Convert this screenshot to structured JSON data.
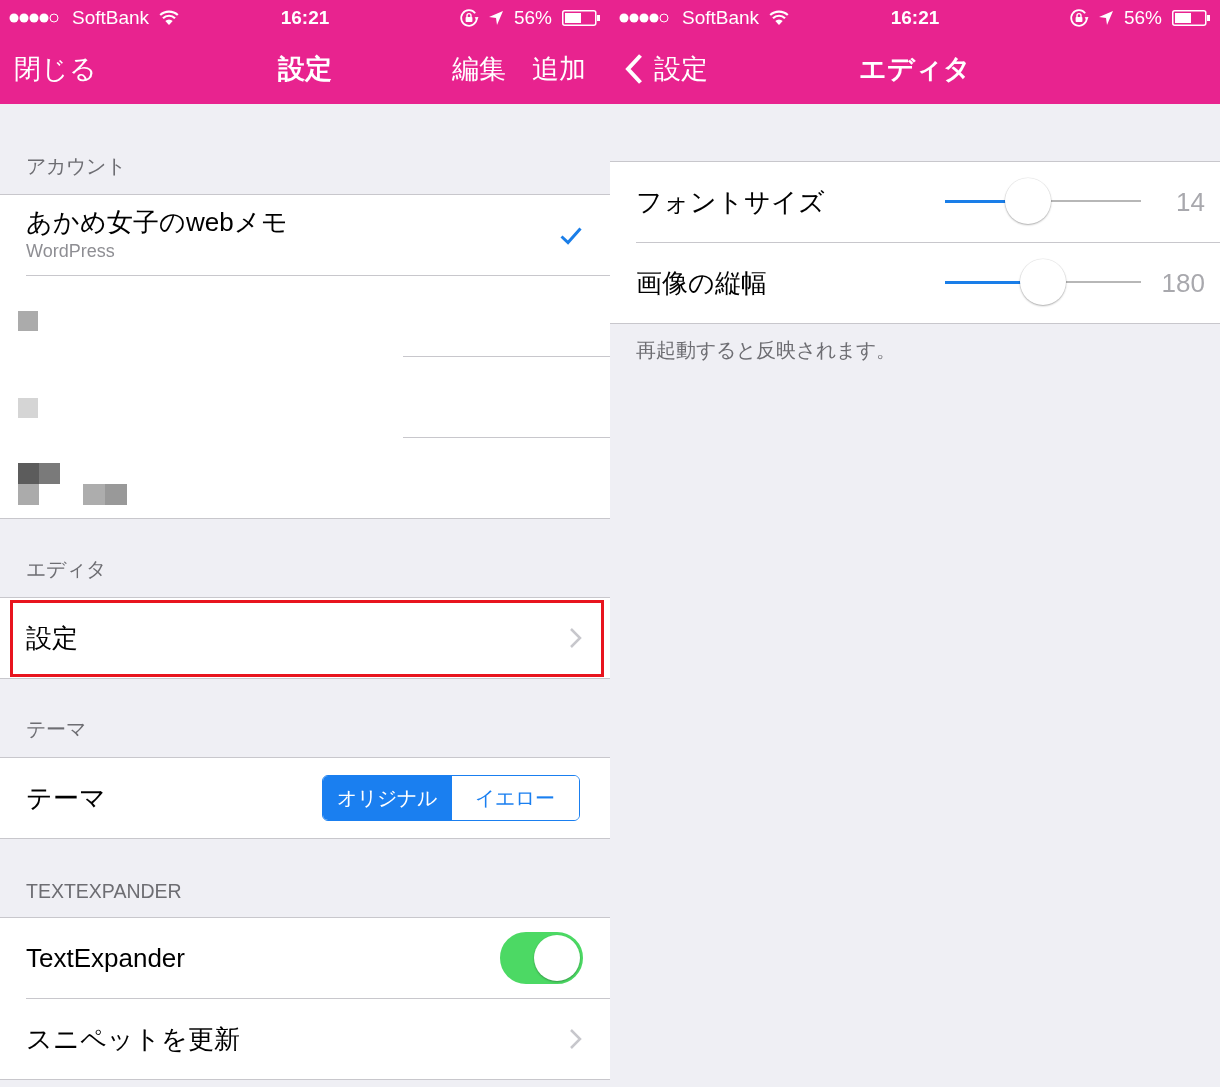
{
  "settings_screen": {
    "status_bar": {
      "carrier": "SoftBank",
      "time": "16:21",
      "battery": "56%"
    },
    "nav_bar": {
      "left_button": "閉じる",
      "title": "設定",
      "right_buttons": [
        "編集",
        "追加"
      ]
    },
    "sections": [
      {
        "header": "アカウント",
        "rows": [
          {
            "kind": "account",
            "title": "あかめ女子のwebメモ",
            "subtitle": "WordPress",
            "selected": true
          },
          {
            "kind": "redacted",
            "selected": false
          },
          {
            "kind": "redacted",
            "selected": false
          },
          {
            "kind": "redacted",
            "selected": false
          }
        ]
      },
      {
        "header": "エディタ",
        "rows": [
          {
            "kind": "link",
            "title": "設定",
            "highlighted": true
          }
        ]
      },
      {
        "header": "テーマ",
        "rows": [
          {
            "kind": "segmented",
            "title": "テーマ",
            "segments": [
              {
                "label": "オリジナル",
                "selected": true
              },
              {
                "label": "イエロー",
                "selected": false
              }
            ]
          }
        ]
      },
      {
        "header": "TEXTEXPANDER",
        "rows": [
          {
            "kind": "toggle",
            "title": "TextExpander",
            "on": true
          },
          {
            "kind": "link",
            "title": "スニペットを更新",
            "highlighted": false
          }
        ]
      }
    ]
  },
  "editor_screen": {
    "status_bar": {
      "carrier": "SoftBank",
      "time": "16:21",
      "battery": "56%"
    },
    "nav_bar": {
      "back_button": "設定",
      "title": "エディタ"
    },
    "sliders": [
      {
        "label": "フォントサイズ",
        "level": 0.4,
        "reading": "14"
      },
      {
        "label": "画像の縦幅",
        "level": 0.5,
        "reading": "180"
      }
    ],
    "footer": "再起動すると反映されます。"
  }
}
